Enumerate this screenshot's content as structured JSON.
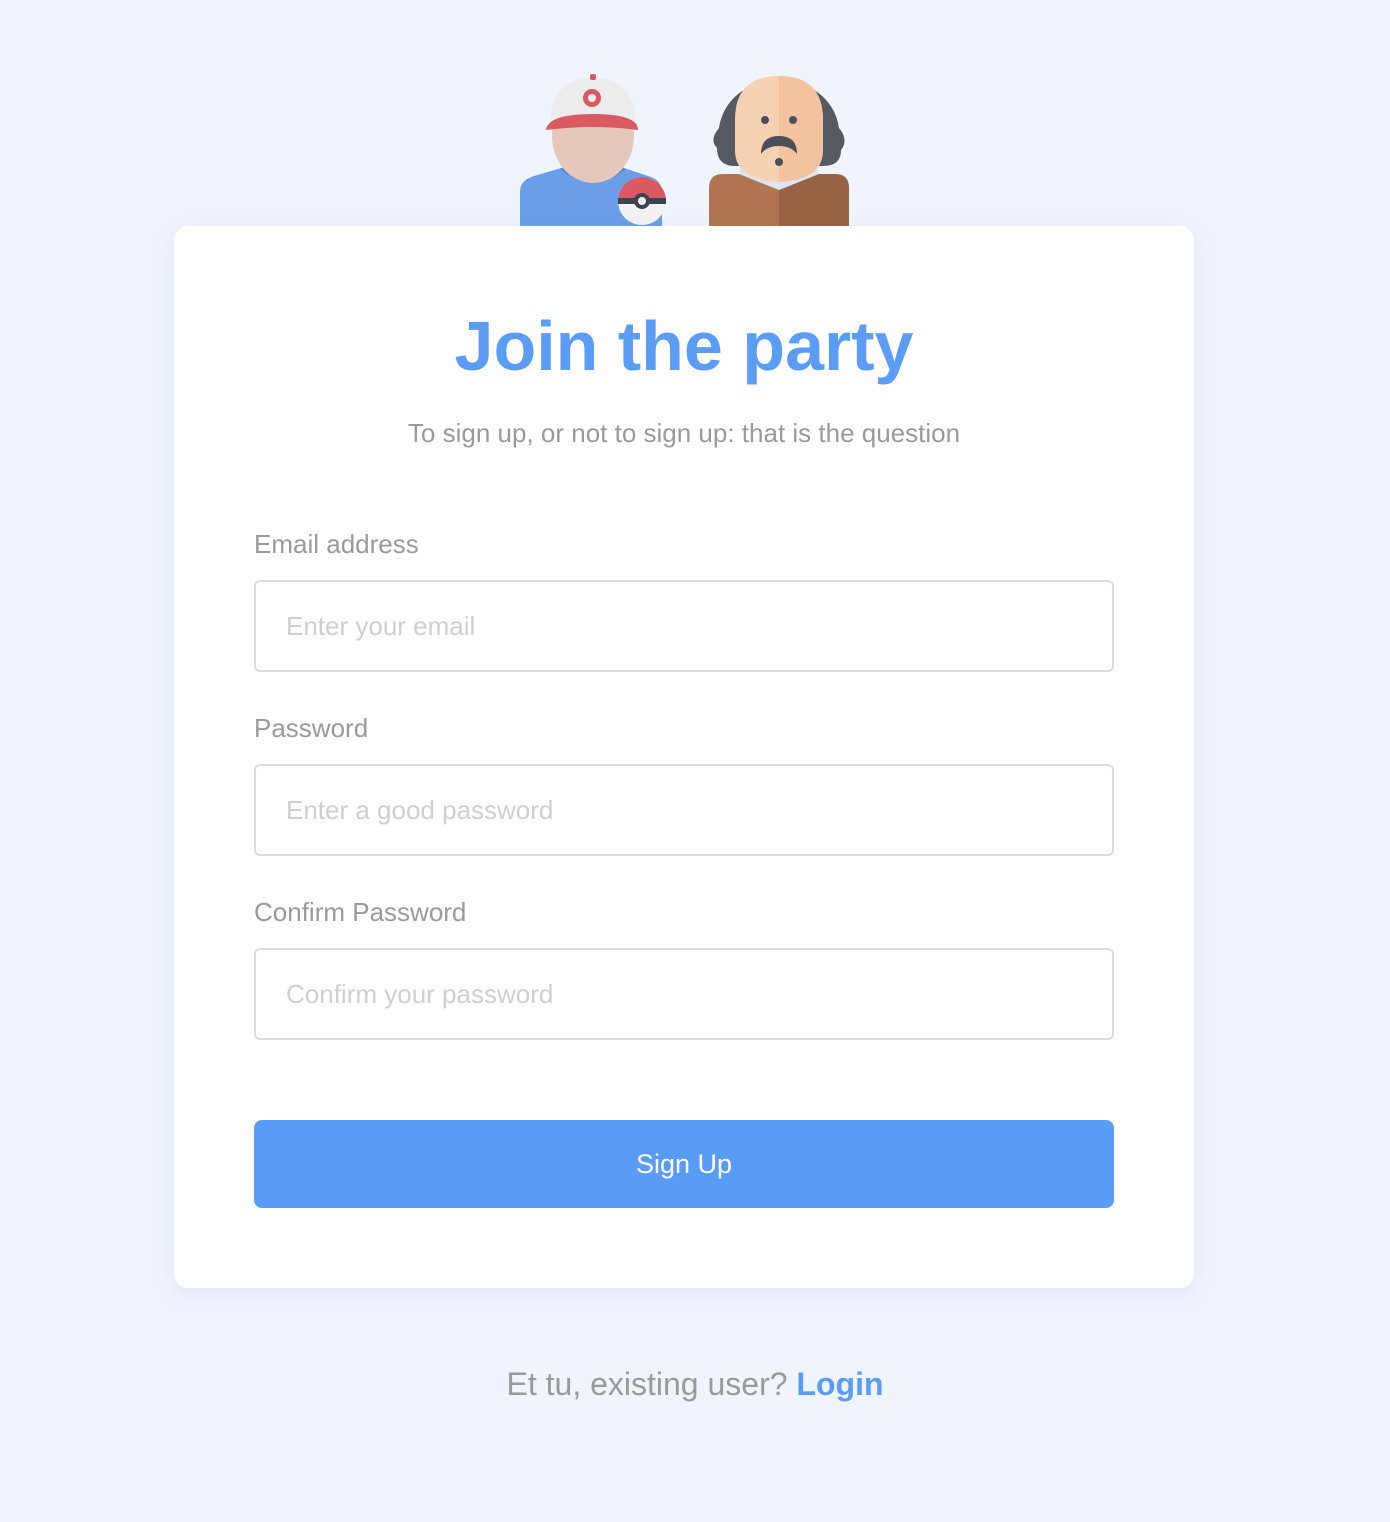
{
  "header": {
    "avatars": [
      {
        "icon": "pokemon-trainer-avatar-icon"
      },
      {
        "icon": "shakespeare-avatar-icon"
      }
    ]
  },
  "card": {
    "title": "Join the party",
    "subtitle": "To sign up, or not to sign up: that is the question"
  },
  "form": {
    "email": {
      "label": "Email address",
      "placeholder": "Enter your email",
      "value": ""
    },
    "password": {
      "label": "Password",
      "placeholder": "Enter a good password",
      "value": ""
    },
    "confirm_password": {
      "label": "Confirm Password",
      "placeholder": "Confirm your password",
      "value": ""
    },
    "submit_label": "Sign Up"
  },
  "footer": {
    "prompt": "Et tu, existing user? ",
    "login_label": "Login"
  },
  "colors": {
    "background": "#f0f4fd",
    "accent": "#589cf7",
    "muted_text": "#9a9a9a"
  }
}
